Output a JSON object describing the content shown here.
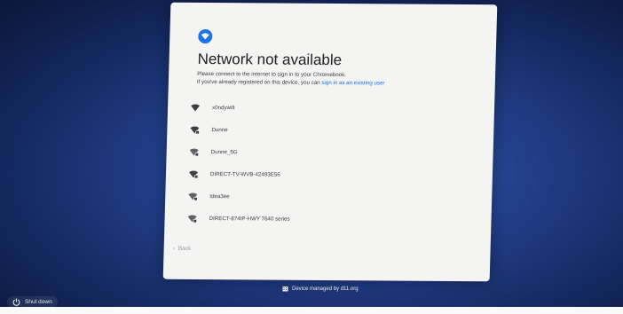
{
  "header": {
    "icon": "wifi-icon",
    "title": "Network not available",
    "desc_line1": "Please connect to the internet to sign in to your Chromebook.",
    "desc_line2_prefix": "If you've already registered on this device, you can ",
    "desc_line2_link": "sign in as an existing user"
  },
  "networks": [
    {
      "name": "x0ndywifi",
      "icon": "wifi-icon"
    },
    {
      "name": "Dunne",
      "icon": "wifi-lock-icon"
    },
    {
      "name": "Dunne_5G",
      "icon": "wifi-lock-icon"
    },
    {
      "name": "DIRECT-TV-WVB-42493E56",
      "icon": "wifi-lock-icon"
    },
    {
      "name": "Idea3ee",
      "icon": "wifi-lock-icon"
    },
    {
      "name": "DIRECT-874IP-HWY 7640 series",
      "icon": "wifi-lock-icon"
    }
  ],
  "footer": {
    "back_label": "Back",
    "managed_label": "Device managed by d11.org",
    "shutdown_label": "Shut down"
  },
  "colors": {
    "accent": "#1a73e8",
    "card": "#f4f4f2",
    "background": "#23418c"
  }
}
